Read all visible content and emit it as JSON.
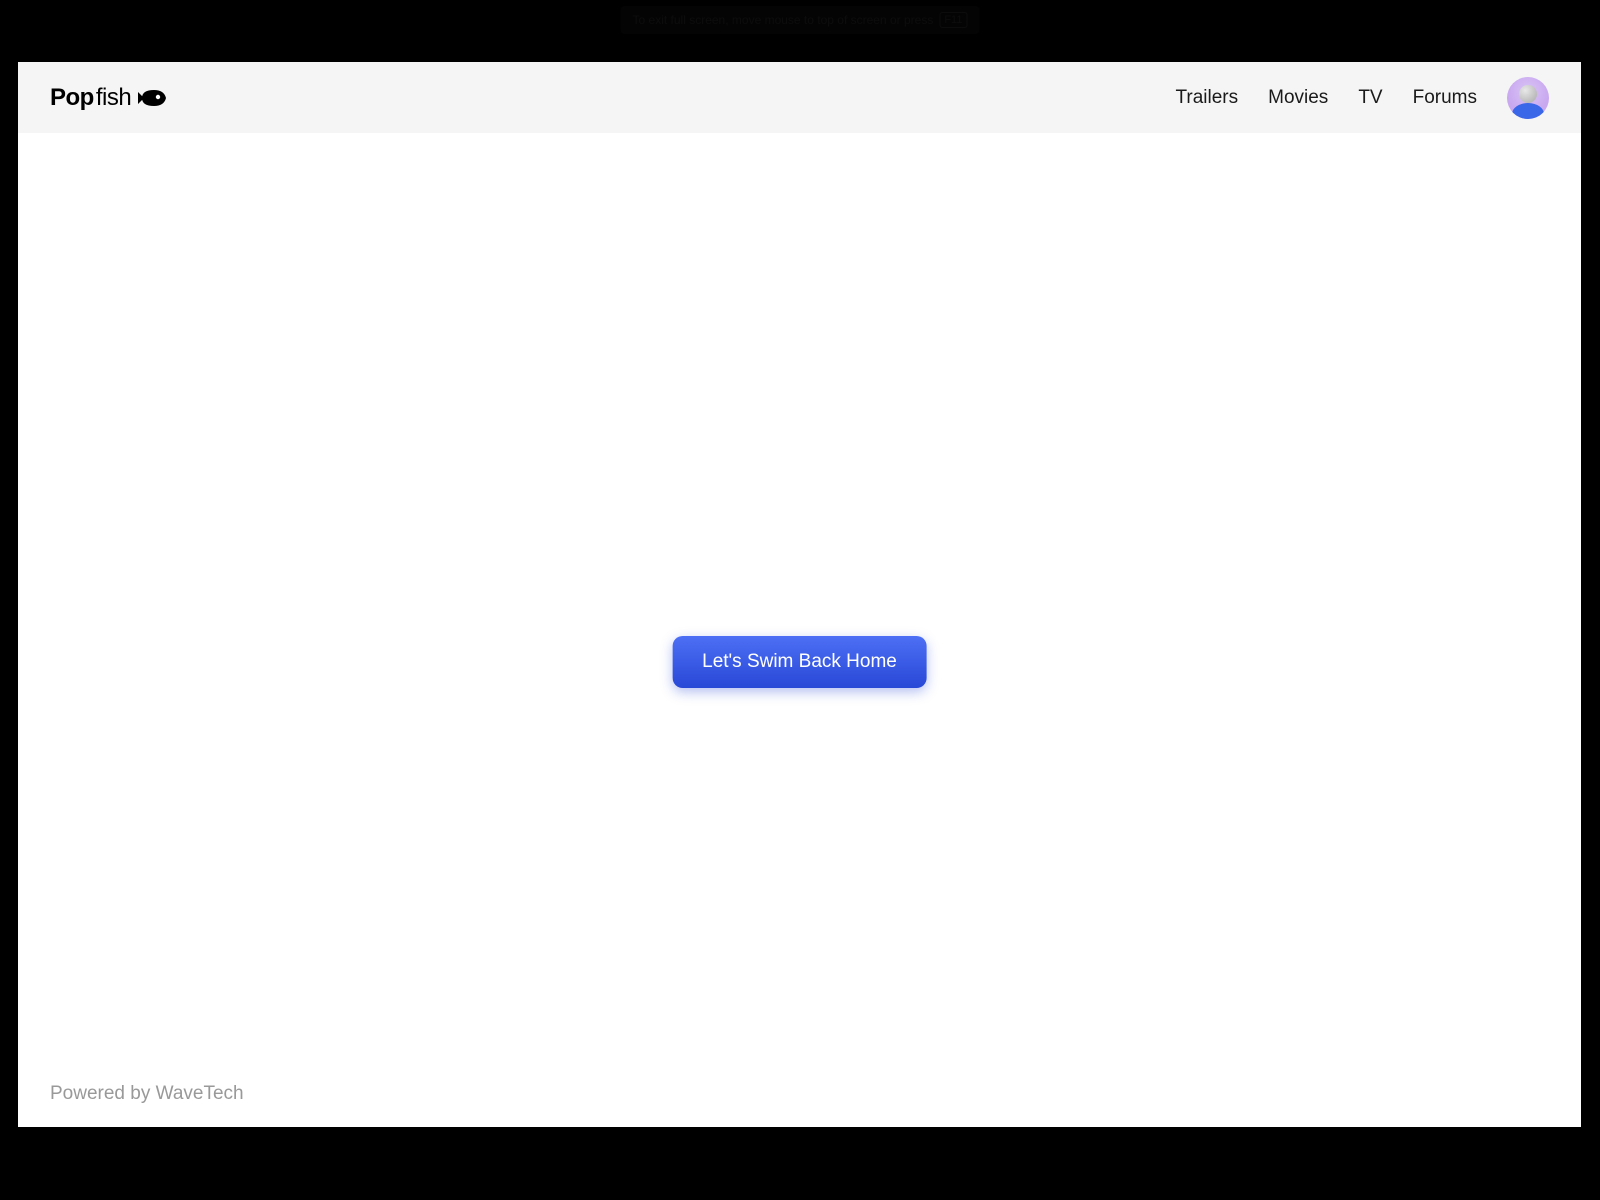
{
  "fullscreen_notice": {
    "text": "To exit full screen, move mouse to top of screen or press",
    "key": "F11"
  },
  "logo": {
    "bold": "Pop",
    "light": "fish"
  },
  "nav": {
    "items": [
      {
        "label": "Trailers"
      },
      {
        "label": "Movies"
      },
      {
        "label": "TV"
      },
      {
        "label": "Forums"
      }
    ]
  },
  "main": {
    "home_button_label": "Let's Swim Back Home"
  },
  "footer": {
    "text": "Powered by WaveTech"
  }
}
